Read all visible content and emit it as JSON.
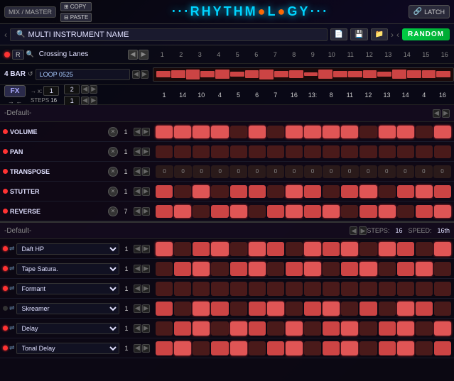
{
  "topBar": {
    "mixMaster": "MIX / MASTER",
    "title1": "RHYTHMOLOGY",
    "copy": "COPY",
    "paste": "PASTE",
    "latch": "LATCH"
  },
  "instrumentBar": {
    "name": "MULTI INSTRUMENT NAME",
    "random": "RANDOM"
  },
  "numberRow": {
    "preset": "Crossing Lanes",
    "numbers": [
      "1",
      "2",
      "3",
      "4",
      "5",
      "6",
      "7",
      "8",
      "9",
      "10",
      "11",
      "12",
      "13",
      "14",
      "15",
      "16"
    ]
  },
  "loopRow": {
    "barLabel": "4 BAR",
    "loopName": "LOOP 0525"
  },
  "fxRow": {
    "stepCount1": "1",
    "value2": "2",
    "steps": "16",
    "stepNums": [
      "1",
      "14",
      "10",
      "4",
      "5",
      "6",
      "7",
      "16",
      "13",
      "8",
      "11",
      "12",
      "13",
      "14",
      "4",
      "16"
    ]
  },
  "defaultSection1": {
    "label": "-Default-",
    "params": [
      {
        "name": "VOLUME",
        "led": true,
        "val": "1"
      },
      {
        "name": "PAN",
        "led": true,
        "val": "1"
      },
      {
        "name": "TRANSPOSE",
        "led": true,
        "val": "1",
        "nums": [
          "0",
          "0",
          "0",
          "0",
          "0",
          "0",
          "0",
          "0",
          "0",
          "0",
          "0",
          "0",
          "0",
          "0",
          "0",
          "0"
        ]
      },
      {
        "name": "STUTTER",
        "led": true,
        "val": "1"
      },
      {
        "name": "REVERSE",
        "led": true,
        "val": "7"
      }
    ]
  },
  "defaultSection2": {
    "label": "-Default-",
    "steps": "16",
    "speed": "16th",
    "plugins": [
      {
        "name": "Daft HP",
        "led": true,
        "val": "1"
      },
      {
        "name": "Tape Satura.",
        "led": true,
        "val": "1"
      },
      {
        "name": "Formant",
        "led": true,
        "val": "1"
      },
      {
        "name": "Skreamer",
        "led": false,
        "val": "1"
      },
      {
        "name": "Delay",
        "led": true,
        "val": "1"
      },
      {
        "name": "Tonal Delay",
        "led": true,
        "val": "1"
      }
    ]
  }
}
